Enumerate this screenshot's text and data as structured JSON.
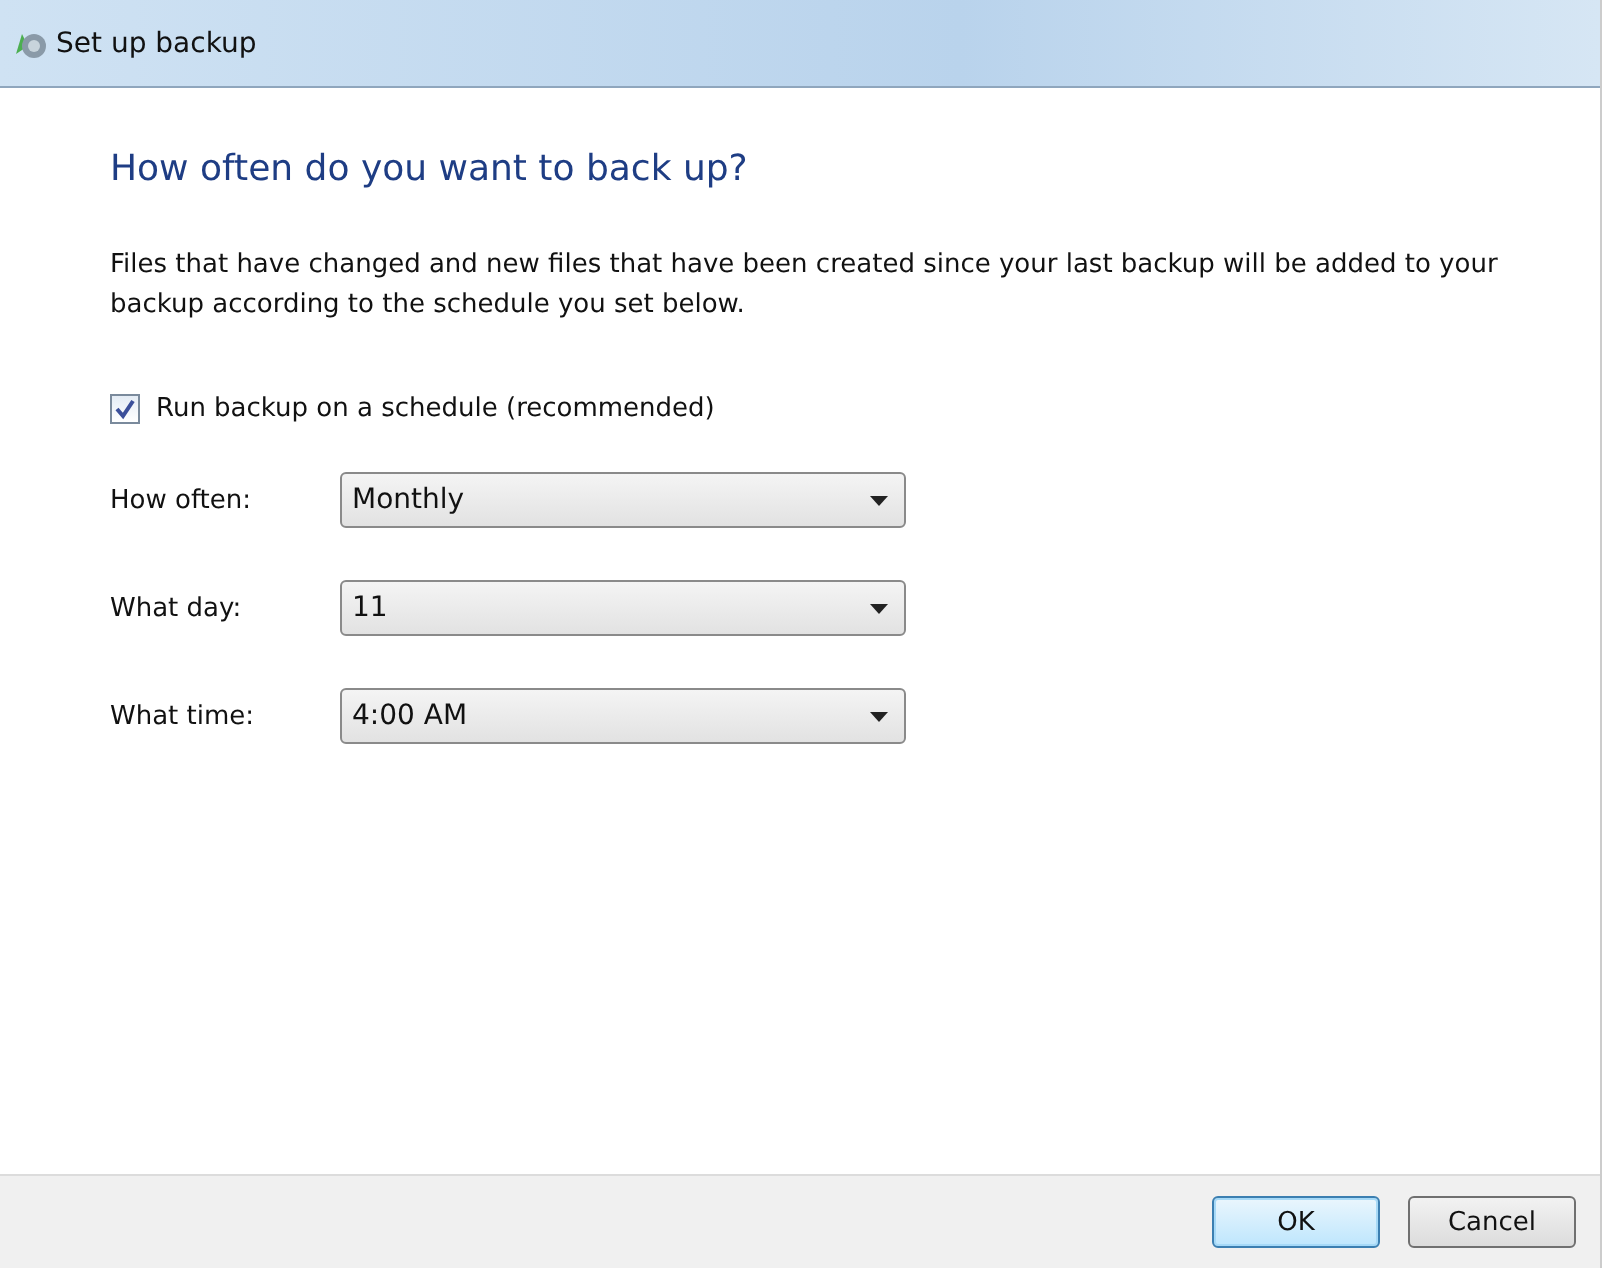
{
  "window": {
    "title": "Set up backup"
  },
  "heading": "How often do you want to back up?",
  "description": "Files that have changed and new files that have been created since your last backup will be added to your backup according to the schedule you set below.",
  "schedule_checkbox": {
    "label": "Run backup on a schedule (recommended)",
    "checked": true
  },
  "fields": [
    {
      "label": "How often:",
      "value": "Monthly"
    },
    {
      "label": "What day:",
      "value": "11"
    },
    {
      "label": "What time:",
      "value": "4:00 AM"
    }
  ],
  "buttons": [
    {
      "label": "OK",
      "default": true
    },
    {
      "label": "Cancel",
      "default": false
    }
  ]
}
